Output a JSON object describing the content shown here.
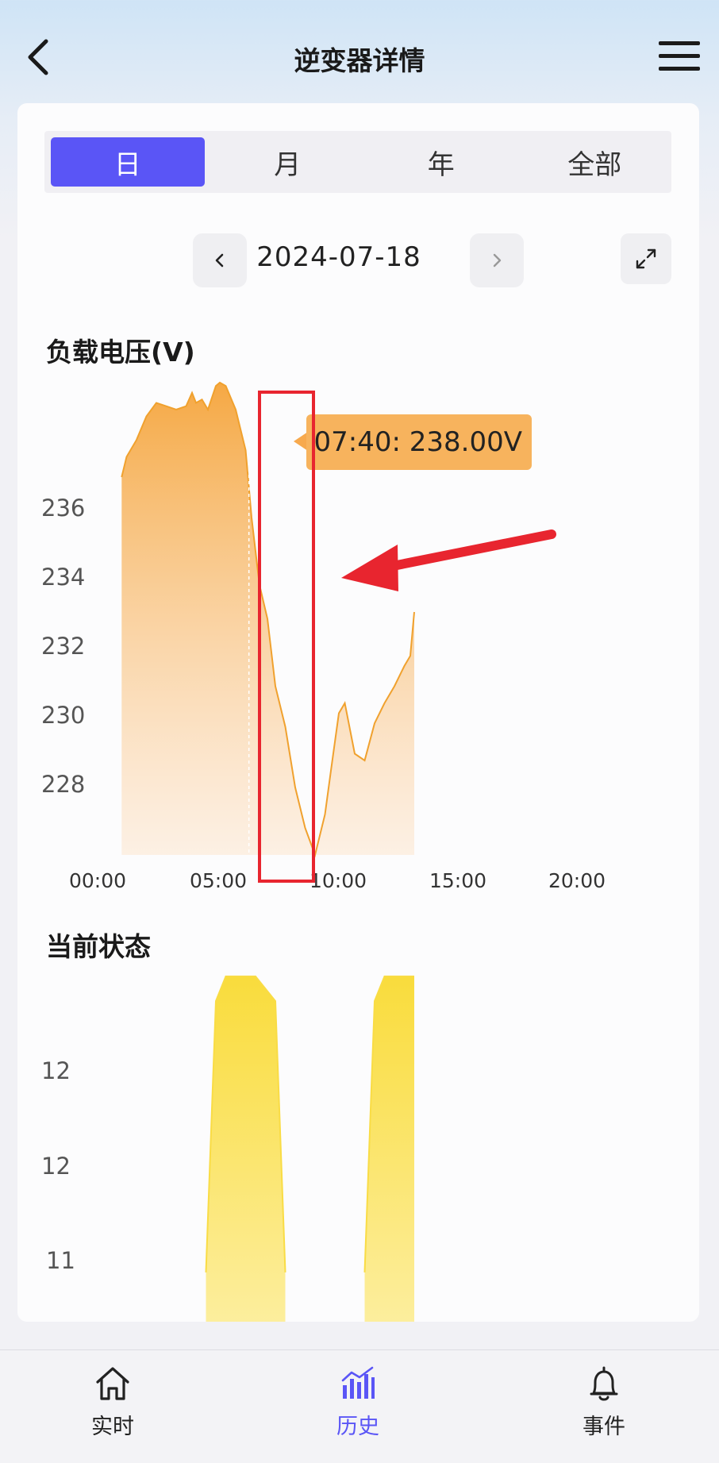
{
  "header": {
    "title": "逆变器详情"
  },
  "tabs": [
    {
      "label": "日",
      "active": true
    },
    {
      "label": "月",
      "active": false
    },
    {
      "label": "年",
      "active": false
    },
    {
      "label": "全部",
      "active": false
    }
  ],
  "date_nav": {
    "date": "2024-07-18"
  },
  "voltage_chart_title": "负载电压(V)",
  "status_chart_title": "当前状态",
  "tooltip": {
    "text": "07:40: 238.00V"
  },
  "bottom_nav": [
    {
      "label": "实时",
      "icon": "home-icon",
      "active": false
    },
    {
      "label": "历史",
      "icon": "bar-chart-icon",
      "active": true
    },
    {
      "label": "事件",
      "icon": "bell-icon",
      "active": false
    }
  ],
  "colors": {
    "accent": "#5a55f6",
    "voltage_line": "#f0a12e",
    "status_fill": "#f9dc45",
    "annotation": "#e8252f"
  },
  "chart_data": [
    {
      "type": "area",
      "title": "负载电压(V)",
      "xlabel": "",
      "ylabel": "",
      "x_ticks": [
        "00:00",
        "05:00",
        "10:00",
        "15:00",
        "20:00"
      ],
      "y_ticks": [
        "236",
        "234",
        "232",
        "230",
        "228"
      ],
      "x_range_hours": [
        0,
        24
      ],
      "ylim": [
        226.0,
        240.0
      ],
      "x": [
        1.25,
        1.5,
        2.0,
        2.5,
        3.0,
        3.5,
        4.0,
        4.5,
        4.8,
        5.0,
        5.3,
        5.6,
        6.0,
        6.2,
        6.5,
        7.0,
        7.5,
        7.8,
        8.2,
        8.6,
        9.0,
        9.5,
        10.0,
        10.5,
        11.0,
        11.5,
        11.8,
        12.2,
        12.5,
        13.0,
        13.5,
        14.0,
        14.5,
        15.0,
        15.5,
        15.8,
        16.0
      ],
      "y": [
        237.2,
        237.8,
        238.3,
        239.0,
        239.4,
        239.3,
        239.2,
        239.3,
        239.7,
        239.4,
        239.5,
        239.2,
        239.9,
        240.0,
        239.9,
        239.2,
        238.0,
        236.0,
        234.0,
        233.0,
        231.0,
        229.8,
        228.0,
        226.8,
        226.0,
        227.2,
        228.5,
        230.2,
        230.5,
        229.0,
        228.8,
        229.9,
        230.5,
        231.0,
        231.6,
        231.9,
        233.2
      ],
      "annotation_time": "07:40"
    },
    {
      "type": "area",
      "title": "当前状态",
      "xlabel": "",
      "ylabel": "",
      "y_ticks": [
        "12",
        "12",
        "11"
      ],
      "x": [
        5.5,
        6.0,
        6.5,
        8.0,
        9.0,
        9.5,
        10.0,
        10.5,
        13.5,
        14.0,
        14.5,
        15.0,
        15.5,
        16.0
      ],
      "y": [
        10.4,
        12.6,
        12.8,
        12.8,
        12.6,
        10.4,
        0,
        0,
        10.4,
        12.6,
        12.8,
        12.8,
        12.8,
        12.8
      ]
    }
  ]
}
